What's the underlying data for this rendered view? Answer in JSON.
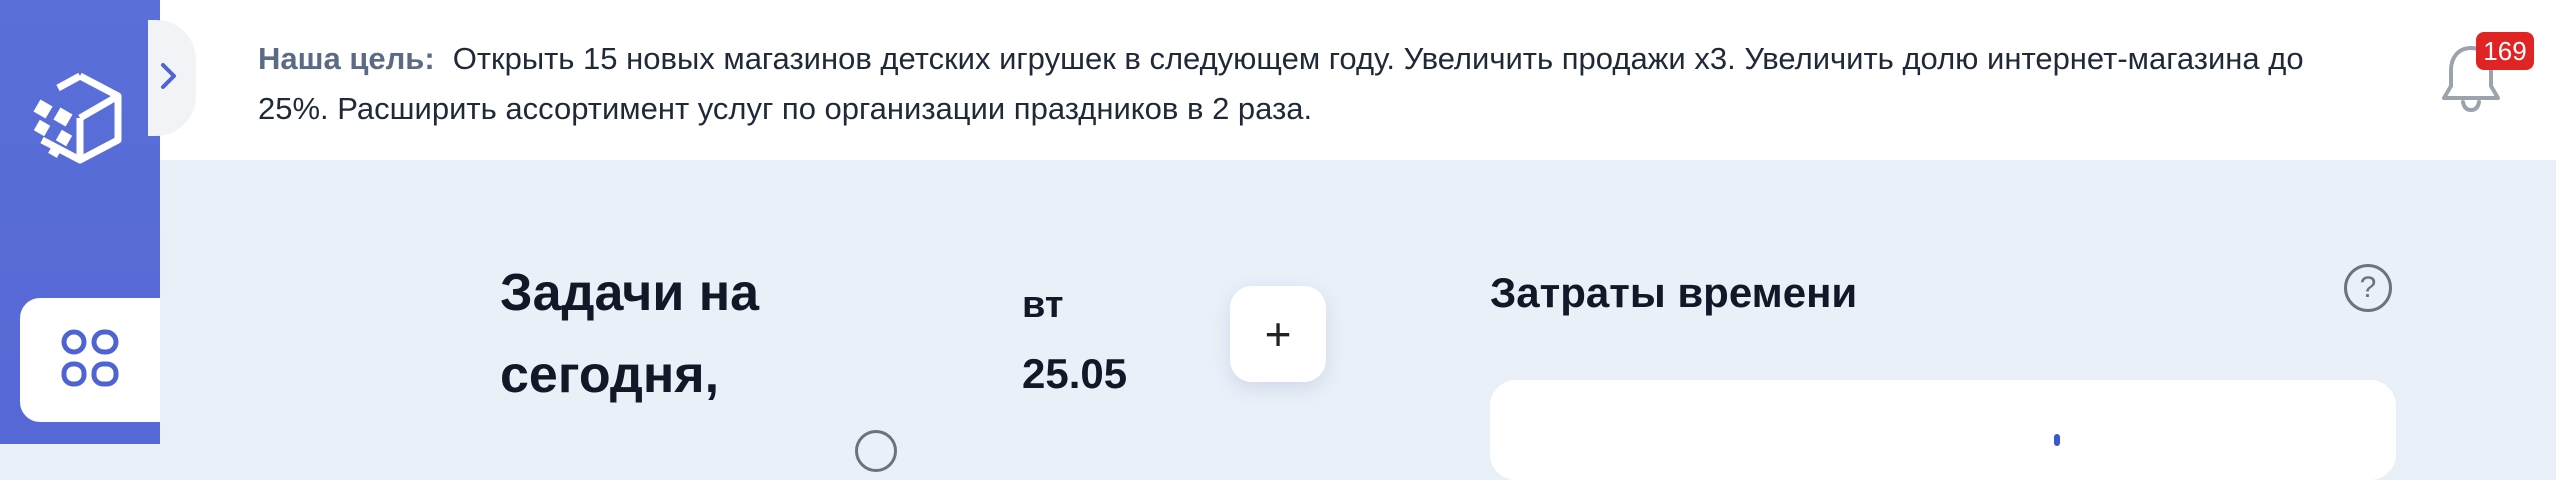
{
  "header": {
    "goal_label": "Наша цель:",
    "goal_text": "Открыть 15 новых магазинов детских игрушек в следующем году. Увеличить продажи х3. Увеличить долю интернет-магазина до 25%. Расширить ассортимент услуг по организации праздников в 2 раза.",
    "notifications_count": "169"
  },
  "tasks": {
    "title": "Задачи на сегодня,",
    "weekday": "вт",
    "date": "25.05",
    "add_label": "+"
  },
  "time_costs": {
    "title": "Затраты времени",
    "help_label": "?"
  },
  "colors": {
    "sidebar": "#5a6fd8",
    "background": "#e9f0f8",
    "badge": "#e02424"
  },
  "icons": {
    "logo": "cube-logo-icon",
    "dashboard": "dashboard-grid-icon",
    "collapse": "chevron-right-icon",
    "bell": "bell-icon",
    "help": "question-circle-icon"
  }
}
